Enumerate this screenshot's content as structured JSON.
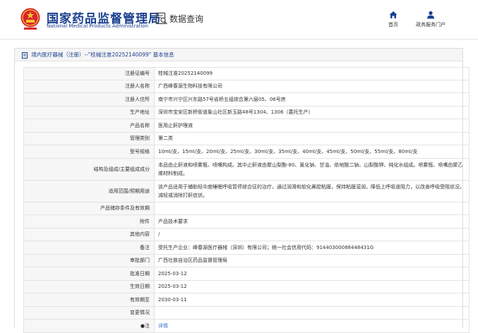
{
  "header": {
    "agency_name": "国家药品监督管理局",
    "agency_name_en": "National Medical Products Administration",
    "query_title": "数据查询",
    "nav": [
      {
        "label": "首页",
        "icon": "home-icon"
      },
      {
        "label": "政务服务门户",
        "icon": "user-icon"
      }
    ]
  },
  "panel": {
    "title": "境内医疗器械（注册）--\"桂械注准20252140099\" 基本信息"
  },
  "fields": [
    {
      "label": "注册证编号",
      "value": "桂械注准20252140099"
    },
    {
      "label": "注册人名称",
      "value": "广西峰春源生物科技有限公司"
    },
    {
      "label": "注册人住所",
      "value": "南宁市兴宁区兴东路57号省桥五组综合第六层05、06号房"
    },
    {
      "label": "生产地址",
      "value": "深圳市宝安区新桥街道象山社区新玉路48号1304、1306（委托生产）"
    },
    {
      "label": "产品名称",
      "value": "医用止鼾护理液"
    },
    {
      "label": "管理类别",
      "value": "第二类"
    },
    {
      "label": "型号规格",
      "value": "10ml/支、15ml/支、20ml/支、25ml/支、30ml/支、35ml/支、40ml/支、45ml/支、50ml/支、55ml/支、80ml/支"
    },
    {
      "label": "结构及组成/主要组成成分",
      "value": "本品由止鼾液和喷雾瓶、喷嘴构成。其中止鼾液由聚山梨酯-80、氯化钠、甘油、依地酸二钠、山梨酸钾、纯化水组成。喷雾瓶、喷嘴由聚乙烯材料制成。"
    },
    {
      "label": "适用范围/预期用途",
      "value": "该产品适用于辅助轻中度睡眠呼吸暂停综合征的治疗，通过润滑和软化鼻腔粘膜，保持粘膜湿润，降低上呼吸道阻力，以改善呼吸受阻状况，减轻或消除打鼾症状。"
    },
    {
      "label": "产品储存条件及有效期",
      "value": ""
    },
    {
      "label": "附件",
      "value": "产品技术要求"
    },
    {
      "label": "其他内容",
      "value": "/"
    },
    {
      "label": "备注",
      "value": "受托生产企业：峰春源医疗器械（深圳）有限公司；统一社会信用代码：91440300088448431G"
    },
    {
      "label": "审批部门",
      "value": "广西壮族自治区药品监督管理局"
    },
    {
      "label": "批准日期",
      "value": "2025-03-12"
    },
    {
      "label": "生效日期",
      "value": "2025-03-12"
    },
    {
      "label": "有效期至",
      "value": "2030-03-11"
    },
    {
      "label": "变更情况",
      "value": ""
    },
    {
      "label": "●注",
      "value": "详情"
    }
  ]
}
